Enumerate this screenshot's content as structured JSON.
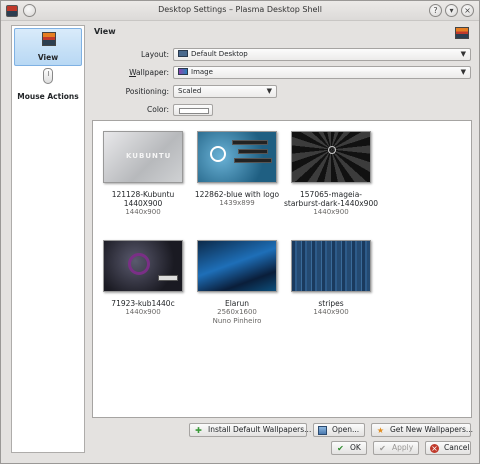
{
  "window": {
    "title": "Desktop Settings – Plasma Desktop Shell"
  },
  "sidebar": {
    "items": [
      {
        "label": "View",
        "icon": "wallpaper-icon",
        "selected": true
      },
      {
        "label": "Mouse Actions",
        "icon": "mouse-icon",
        "selected": false
      }
    ]
  },
  "main": {
    "heading": "View",
    "form": {
      "layout_label": "Layout:",
      "layout_value": "Default Desktop",
      "wallpaper_label_u": "W",
      "wallpaper_label_rest": "allpaper:",
      "wallpaper_value": "Image",
      "positioning_label": "Positioning:",
      "positioning_value": "Scaled",
      "color_label": "Color:"
    },
    "wallpapers": [
      {
        "name": "121128-Kubuntu 1440X900",
        "size": "1440x900",
        "author": "",
        "thumb_text": "KUBUNTU"
      },
      {
        "name": "122862-blue with logo",
        "size": "1439x899",
        "author": ""
      },
      {
        "name": "157065-mageia-starburst-dark-1440x900",
        "size": "1440x900",
        "author": ""
      },
      {
        "name": "71923-kub1440c",
        "size": "1440x900",
        "author": ""
      },
      {
        "name": "Elarun",
        "size": "2560x1600",
        "author": "Nuno Pinheiro"
      },
      {
        "name": "stripes",
        "size": "1440x900",
        "author": ""
      }
    ]
  },
  "buttons": {
    "install": "Install Default Wallpapers...",
    "open": "Open...",
    "get_new": "Get New Wallpapers...",
    "ok": "OK",
    "apply": "Apply",
    "cancel": "Cancel"
  }
}
